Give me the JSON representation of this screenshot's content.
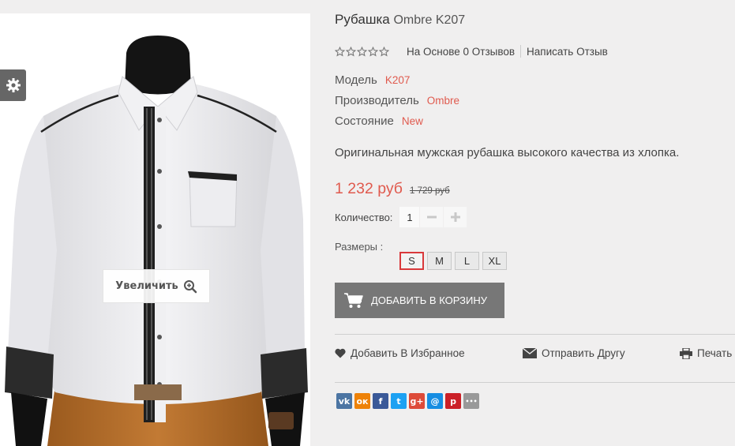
{
  "product": {
    "name": "Рубашка",
    "model_title": "Ombre K207",
    "rating": {
      "stars_filled": 0,
      "stars_total": 5,
      "reviews_text": "На Основе 0 Отзывов",
      "write_review": "Написать Отзыв"
    },
    "attributes": {
      "model_label": "Модель",
      "model_value": "K207",
      "manufacturer_label": "Производитель",
      "manufacturer_value": "Ombre",
      "condition_label": "Состояние",
      "condition_value": "New"
    },
    "description": "Оригинальная мужская рубашка высокого качества из хлопка.",
    "price": {
      "current": "1 232 руб",
      "old": "1 729 руб"
    },
    "quantity": {
      "label": "Количество:",
      "value": "1"
    },
    "sizes": {
      "label": "Размеры :",
      "options": [
        "S",
        "M",
        "L",
        "XL"
      ],
      "selected": "S"
    },
    "add_to_cart": "ДОБАВИТЬ В КОРЗИНУ",
    "actions": {
      "wishlist": "Добавить В Избранное",
      "send_friend": "Отправить Другу",
      "print": "Печать"
    }
  },
  "image": {
    "zoom_label": "Увеличить"
  },
  "share": [
    {
      "icon": "vk-icon",
      "glyph": "vk",
      "color": "#4c75a3"
    },
    {
      "icon": "odnoklassniki-icon",
      "glyph": "ок",
      "color": "#ee8208"
    },
    {
      "icon": "facebook-icon",
      "glyph": "f",
      "color": "#3b5998"
    },
    {
      "icon": "twitter-icon",
      "glyph": "t",
      "color": "#1da1f2"
    },
    {
      "icon": "google-plus-icon",
      "glyph": "g+",
      "color": "#dd4b39"
    },
    {
      "icon": "mailru-icon",
      "glyph": "@",
      "color": "#168de2"
    },
    {
      "icon": "pinterest-icon",
      "glyph": "p",
      "color": "#cb2027"
    },
    {
      "icon": "more-icon",
      "glyph": "•••",
      "color": "#999999"
    }
  ],
  "colors": {
    "accent": "#e05a4e",
    "button": "#777777",
    "size_selected_border": "#d9393b"
  }
}
